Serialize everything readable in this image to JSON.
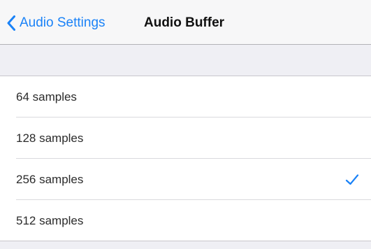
{
  "nav": {
    "back_label": "Audio Settings",
    "title": "Audio Buffer"
  },
  "options": [
    {
      "label": "64 samples",
      "selected": false
    },
    {
      "label": "128 samples",
      "selected": false
    },
    {
      "label": "256 samples",
      "selected": true
    },
    {
      "label": "512 samples",
      "selected": false
    }
  ],
  "colors": {
    "accent": "#1a82f7",
    "background": "#efeff4"
  },
  "icons": {
    "back": "chevron-left-icon",
    "selected": "checkmark-icon"
  }
}
